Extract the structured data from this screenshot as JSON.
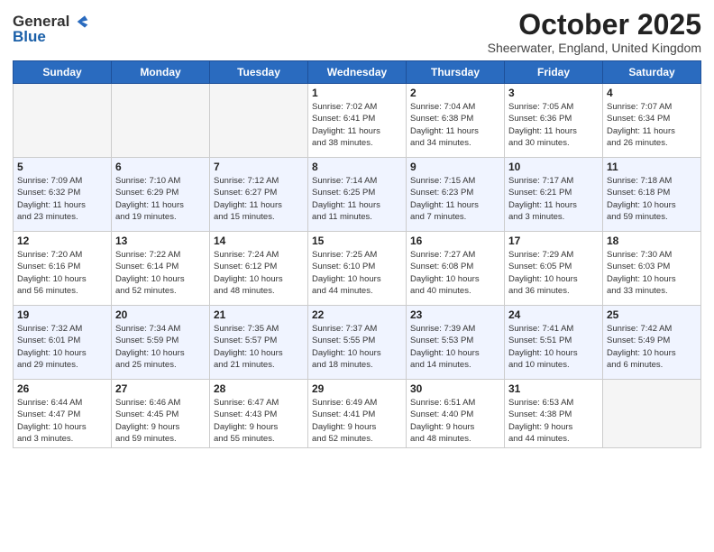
{
  "header": {
    "logo_line1": "General",
    "logo_line2": "Blue",
    "title": "October 2025",
    "subtitle": "Sheerwater, England, United Kingdom"
  },
  "weekdays": [
    "Sunday",
    "Monday",
    "Tuesday",
    "Wednesday",
    "Thursday",
    "Friday",
    "Saturday"
  ],
  "weeks": [
    [
      {
        "day": "",
        "info": ""
      },
      {
        "day": "",
        "info": ""
      },
      {
        "day": "",
        "info": ""
      },
      {
        "day": "1",
        "info": "Sunrise: 7:02 AM\nSunset: 6:41 PM\nDaylight: 11 hours\nand 38 minutes."
      },
      {
        "day": "2",
        "info": "Sunrise: 7:04 AM\nSunset: 6:38 PM\nDaylight: 11 hours\nand 34 minutes."
      },
      {
        "day": "3",
        "info": "Sunrise: 7:05 AM\nSunset: 6:36 PM\nDaylight: 11 hours\nand 30 minutes."
      },
      {
        "day": "4",
        "info": "Sunrise: 7:07 AM\nSunset: 6:34 PM\nDaylight: 11 hours\nand 26 minutes."
      }
    ],
    [
      {
        "day": "5",
        "info": "Sunrise: 7:09 AM\nSunset: 6:32 PM\nDaylight: 11 hours\nand 23 minutes."
      },
      {
        "day": "6",
        "info": "Sunrise: 7:10 AM\nSunset: 6:29 PM\nDaylight: 11 hours\nand 19 minutes."
      },
      {
        "day": "7",
        "info": "Sunrise: 7:12 AM\nSunset: 6:27 PM\nDaylight: 11 hours\nand 15 minutes."
      },
      {
        "day": "8",
        "info": "Sunrise: 7:14 AM\nSunset: 6:25 PM\nDaylight: 11 hours\nand 11 minutes."
      },
      {
        "day": "9",
        "info": "Sunrise: 7:15 AM\nSunset: 6:23 PM\nDaylight: 11 hours\nand 7 minutes."
      },
      {
        "day": "10",
        "info": "Sunrise: 7:17 AM\nSunset: 6:21 PM\nDaylight: 11 hours\nand 3 minutes."
      },
      {
        "day": "11",
        "info": "Sunrise: 7:18 AM\nSunset: 6:18 PM\nDaylight: 10 hours\nand 59 minutes."
      }
    ],
    [
      {
        "day": "12",
        "info": "Sunrise: 7:20 AM\nSunset: 6:16 PM\nDaylight: 10 hours\nand 56 minutes."
      },
      {
        "day": "13",
        "info": "Sunrise: 7:22 AM\nSunset: 6:14 PM\nDaylight: 10 hours\nand 52 minutes."
      },
      {
        "day": "14",
        "info": "Sunrise: 7:24 AM\nSunset: 6:12 PM\nDaylight: 10 hours\nand 48 minutes."
      },
      {
        "day": "15",
        "info": "Sunrise: 7:25 AM\nSunset: 6:10 PM\nDaylight: 10 hours\nand 44 minutes."
      },
      {
        "day": "16",
        "info": "Sunrise: 7:27 AM\nSunset: 6:08 PM\nDaylight: 10 hours\nand 40 minutes."
      },
      {
        "day": "17",
        "info": "Sunrise: 7:29 AM\nSunset: 6:05 PM\nDaylight: 10 hours\nand 36 minutes."
      },
      {
        "day": "18",
        "info": "Sunrise: 7:30 AM\nSunset: 6:03 PM\nDaylight: 10 hours\nand 33 minutes."
      }
    ],
    [
      {
        "day": "19",
        "info": "Sunrise: 7:32 AM\nSunset: 6:01 PM\nDaylight: 10 hours\nand 29 minutes."
      },
      {
        "day": "20",
        "info": "Sunrise: 7:34 AM\nSunset: 5:59 PM\nDaylight: 10 hours\nand 25 minutes."
      },
      {
        "day": "21",
        "info": "Sunrise: 7:35 AM\nSunset: 5:57 PM\nDaylight: 10 hours\nand 21 minutes."
      },
      {
        "day": "22",
        "info": "Sunrise: 7:37 AM\nSunset: 5:55 PM\nDaylight: 10 hours\nand 18 minutes."
      },
      {
        "day": "23",
        "info": "Sunrise: 7:39 AM\nSunset: 5:53 PM\nDaylight: 10 hours\nand 14 minutes."
      },
      {
        "day": "24",
        "info": "Sunrise: 7:41 AM\nSunset: 5:51 PM\nDaylight: 10 hours\nand 10 minutes."
      },
      {
        "day": "25",
        "info": "Sunrise: 7:42 AM\nSunset: 5:49 PM\nDaylight: 10 hours\nand 6 minutes."
      }
    ],
    [
      {
        "day": "26",
        "info": "Sunrise: 6:44 AM\nSunset: 4:47 PM\nDaylight: 10 hours\nand 3 minutes."
      },
      {
        "day": "27",
        "info": "Sunrise: 6:46 AM\nSunset: 4:45 PM\nDaylight: 9 hours\nand 59 minutes."
      },
      {
        "day": "28",
        "info": "Sunrise: 6:47 AM\nSunset: 4:43 PM\nDaylight: 9 hours\nand 55 minutes."
      },
      {
        "day": "29",
        "info": "Sunrise: 6:49 AM\nSunset: 4:41 PM\nDaylight: 9 hours\nand 52 minutes."
      },
      {
        "day": "30",
        "info": "Sunrise: 6:51 AM\nSunset: 4:40 PM\nDaylight: 9 hours\nand 48 minutes."
      },
      {
        "day": "31",
        "info": "Sunrise: 6:53 AM\nSunset: 4:38 PM\nDaylight: 9 hours\nand 44 minutes."
      },
      {
        "day": "",
        "info": ""
      }
    ]
  ]
}
